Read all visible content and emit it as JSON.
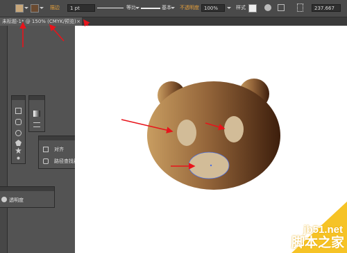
{
  "control_bar": {
    "stroke_label": "描边",
    "stroke_weight": "1 pt",
    "stroke_profile": "等比",
    "brush": "基本",
    "opacity_label": "不透明度",
    "opacity_value": "100%",
    "style_label": "样式",
    "coordinate": "237.667"
  },
  "document_tab": {
    "title": "未标题-1* @ 150% (CMYK/预览)",
    "close": "×"
  },
  "panels": {
    "align_label": "对齐",
    "pathfinder_label": "路径查找器",
    "transparency_label": "透明度"
  },
  "watermark": {
    "site": "jb51.net",
    "brand": "脚本之家"
  },
  "colors": {
    "bear_light": "#c59a5e",
    "bear_dark": "#3d1e0c",
    "feature_fill": "#d2bc98",
    "arrow": "#e8141b",
    "selection": "#4a6ee0"
  }
}
